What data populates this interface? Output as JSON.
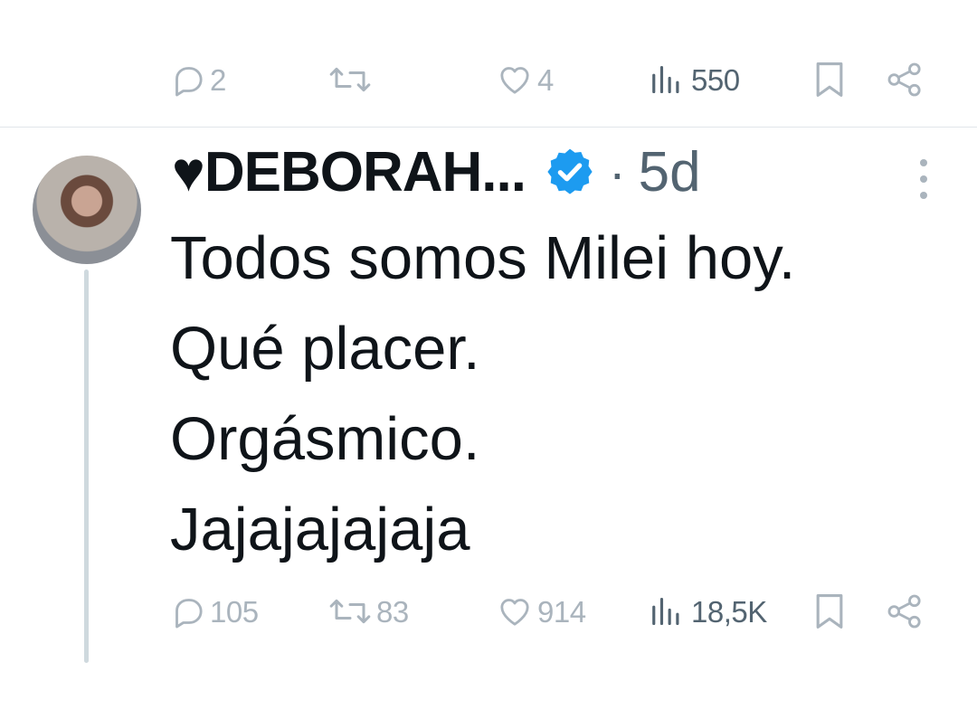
{
  "previous_tweet": {
    "actions": {
      "replies": "2",
      "retweets": "",
      "likes": "4",
      "views": "550"
    }
  },
  "tweet": {
    "author": {
      "display_name": "♥DEBORAH...",
      "verified": true
    },
    "separator": "·",
    "timestamp": "5d",
    "text_lines": [
      "Todos somos Milei hoy.",
      "Qué placer.",
      "Orgásmico.",
      "Jajajajajaja"
    ],
    "actions": {
      "replies": "105",
      "retweets": "83",
      "likes": "914",
      "views": "18,5K"
    }
  },
  "colors": {
    "text": "#0f1419",
    "secondary": "#536471",
    "icon_muted": "#aab4bd",
    "verified_badge": "#1d9bf0",
    "divider": "#e1e6ea",
    "thread_line": "#cfd9de"
  },
  "icons": [
    "reply-icon",
    "retweet-icon",
    "like-icon",
    "views-icon",
    "bookmark-icon",
    "share-icon",
    "verified-badge-icon",
    "more-icon"
  ]
}
